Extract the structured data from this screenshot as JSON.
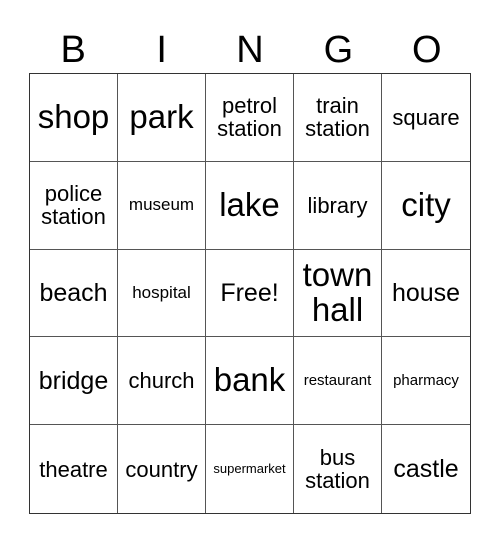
{
  "header": [
    "B",
    "I",
    "N",
    "G",
    "O"
  ],
  "cells": [
    "shop",
    "park",
    "petrol\nstation",
    "train\nstation",
    "square",
    "police\nstation",
    "museum",
    "lake",
    "library",
    "city",
    "beach",
    "hospital",
    "Free!",
    "town\nhall",
    "house",
    "bridge",
    "church",
    "bank",
    "restaurant",
    "pharmacy",
    "theatre",
    "country",
    "supermarket",
    "bus\nstation",
    "castle"
  ]
}
